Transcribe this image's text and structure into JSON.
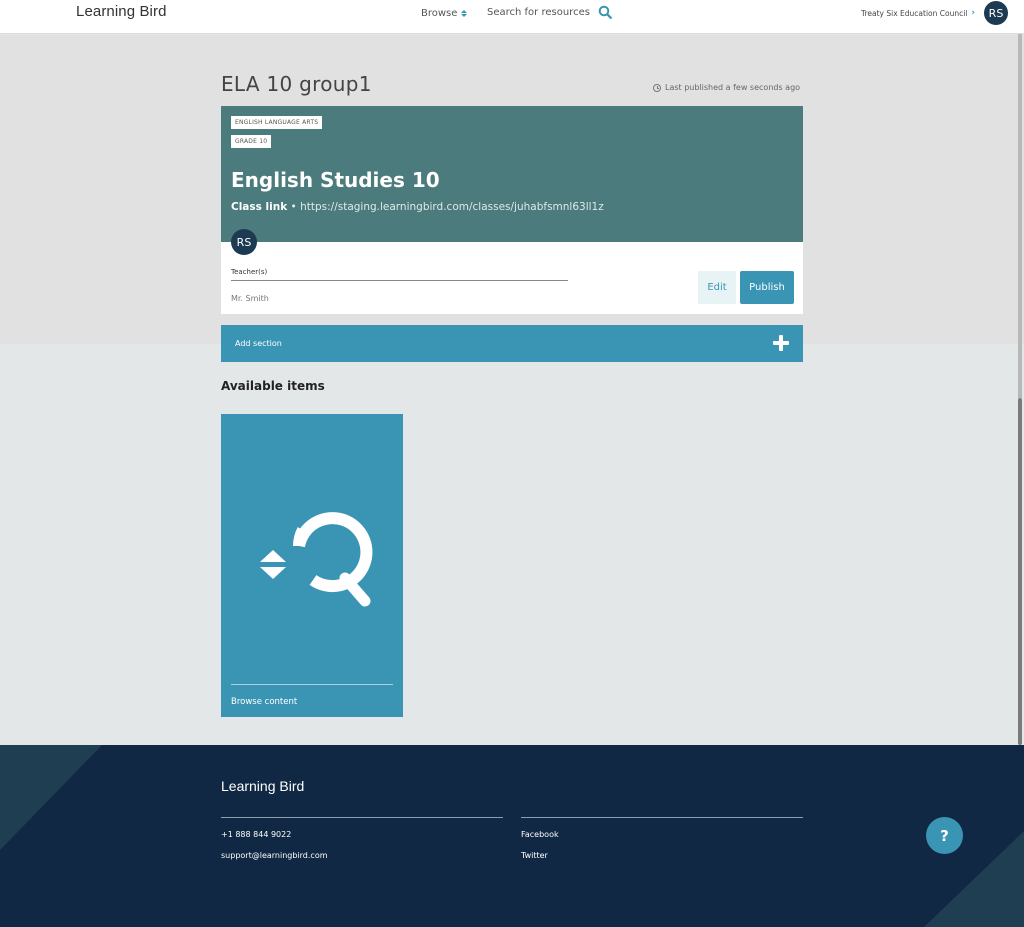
{
  "header": {
    "logo": "Learning Bird",
    "browse_label": "Browse",
    "search_label": "Search for resources",
    "org_name": "Treaty Six Education Council",
    "user_initials": "RS"
  },
  "page": {
    "title": "ELA 10 group1",
    "last_published": "Last published a few seconds ago"
  },
  "class_card": {
    "tags": [
      "ENGLISH LANGUAGE ARTS",
      "GRADE 10"
    ],
    "course_title": "English Studies 10",
    "class_link_label": "Class link",
    "class_link_separator": "•",
    "class_link_url": "https://staging.learningbird.com/classes/juhabfsmnl63ll1z",
    "teacher_initials": "RS",
    "teacher_label": "Teacher(s)",
    "teacher_name": "Mr. Smith",
    "edit_label": "Edit",
    "publish_label": "Publish"
  },
  "add_section": {
    "label": "Add section"
  },
  "available_items": {
    "title": "Available items",
    "tiles": [
      {
        "label": "Browse content",
        "icon": "browse-search-icon"
      }
    ]
  },
  "footer": {
    "logo": "Learning Bird",
    "phone": "+1 888 844 9022",
    "email": "support@learningbird.com",
    "facebook": "Facebook",
    "twitter": "Twitter",
    "help_label": "?"
  },
  "colors": {
    "accent": "#3a95b4",
    "card_header": "#4b7b7c",
    "avatar": "#1c3a52",
    "footer_bg": "#102843"
  }
}
